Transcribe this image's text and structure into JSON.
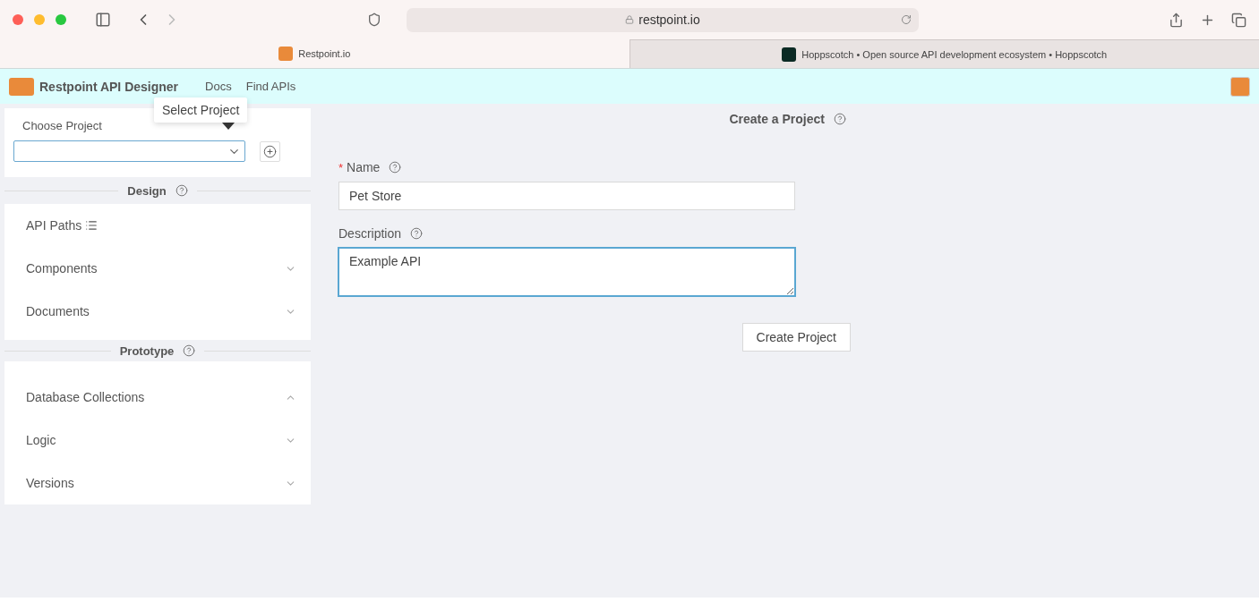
{
  "browser": {
    "url": "restpoint.io",
    "tabs": [
      {
        "title": "Restpoint.io",
        "selected": true
      },
      {
        "title": "Hoppscotch • Open source API development ecosystem • Hoppscotch",
        "selected": false
      }
    ]
  },
  "header": {
    "title": "Restpoint API Designer",
    "nav": [
      "Docs",
      "Find APIs"
    ]
  },
  "sidebar": {
    "project_label": "Choose Project",
    "tooltip": "Select Project",
    "sections": [
      {
        "title": "Design",
        "items": [
          {
            "label": "API Paths",
            "kind": "link"
          },
          {
            "label": "Components",
            "kind": "accordion",
            "expanded": false
          },
          {
            "label": "Documents",
            "kind": "accordion",
            "expanded": false
          }
        ]
      },
      {
        "title": "Prototype",
        "items": [
          {
            "label": "Database Collections",
            "kind": "accordion",
            "expanded": true
          },
          {
            "label": "Logic",
            "kind": "accordion",
            "expanded": false
          },
          {
            "label": "Versions",
            "kind": "accordion",
            "expanded": false
          }
        ]
      }
    ]
  },
  "form": {
    "title": "Create a Project",
    "fields": [
      {
        "label": "Name",
        "required_mark": "*",
        "kind": "input",
        "value": "Pet Store",
        "focused": false
      },
      {
        "label": "Description",
        "kind": "textarea",
        "value": "Example API",
        "focused": true
      }
    ],
    "submit": "Create Project"
  }
}
